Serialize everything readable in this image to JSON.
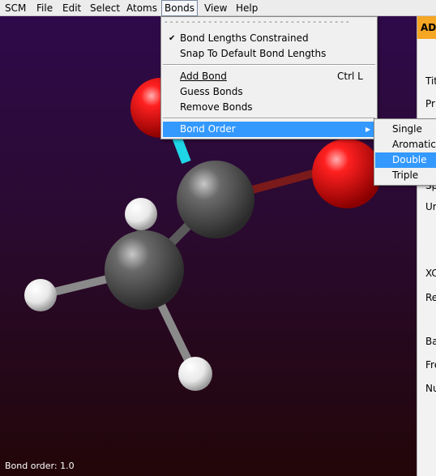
{
  "menubar": {
    "items": [
      {
        "label": "SCM",
        "key": "scm"
      },
      {
        "label": "File",
        "key": "file"
      },
      {
        "label": "Edit",
        "key": "edit"
      },
      {
        "label": "Select",
        "key": "select"
      },
      {
        "label": "Atoms",
        "key": "atoms"
      },
      {
        "label": "Bonds",
        "key": "bonds"
      },
      {
        "label": "View",
        "key": "view"
      },
      {
        "label": "Help",
        "key": "help"
      }
    ]
  },
  "bonds_menu": {
    "tearoff": "- - - - - - - - - - - - - - - - - - - - - - - - - - - - - - - - - -",
    "bond_lengths_constrained": "Bond Lengths Constrained",
    "check_mark": "✔",
    "snap_to_default": "Snap To Default Bond Lengths",
    "add_bond": "Add Bond",
    "add_bond_shortcut": "Ctrl L",
    "guess_bonds": "Guess Bonds",
    "remove_bonds": "Remove Bonds",
    "bond_order": "Bond Order",
    "submenu_arrow": "▶"
  },
  "bond_order_submenu": {
    "single": "Single",
    "aromatic": "Aromatic",
    "double": "Double",
    "triple": "Triple"
  },
  "right_panel": {
    "header": "AD",
    "labels": [
      "Tit",
      "Pr",
      "Sp",
      "Ur",
      "XC",
      "Re",
      "Ba",
      "Fre",
      "Nu"
    ]
  },
  "status_bar": {
    "text": "Bond order: 1.0"
  },
  "colors": {
    "menu_highlight": "#3399ff",
    "panel_header": "#f5a623",
    "oxygen": "#e00000",
    "carbon": "#555555",
    "hydrogen": "#f4f4f4",
    "selected_bond": "#1fd6e6"
  }
}
